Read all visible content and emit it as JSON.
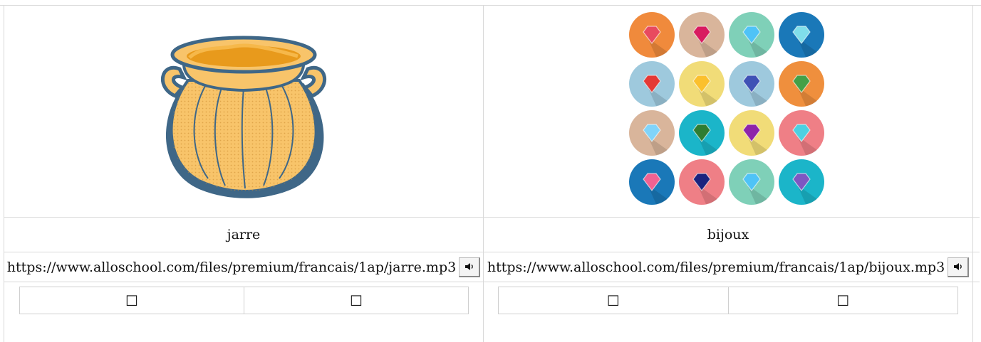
{
  "cards": [
    {
      "image_icon": "cooking-pot-jar-illustration",
      "word": "jarre",
      "audio_url": "https://www.alloschool.com/files/premium/francais/1ap/jarre.mp3",
      "audio_icon": "speaker-icon",
      "choices": [
        "☐",
        "☐"
      ]
    },
    {
      "image_icon": "jewelry-icons-grid",
      "word": "bijoux",
      "audio_url": "https://www.alloschool.com/files/premium/francais/1ap/bijoux.mp3",
      "audio_icon": "speaker-icon",
      "choices": [
        "☐",
        "☐"
      ]
    }
  ],
  "colors": {
    "pot_fill": "#f8c46a",
    "pot_outline": "#3f6787",
    "grid_line": "#d9d9d9",
    "jewel_circles": [
      "#f08a3c",
      "#d9b59b",
      "#7fd0b8",
      "#1a78b8",
      "#9ec9dd",
      "#f1dc78",
      "#9ec9dd",
      "#ef8f3d",
      "#d9b59b",
      "#1bb5c9",
      "#f1dc78",
      "#ef7f86",
      "#1a78b8",
      "#ef7f86",
      "#7fd0b8",
      "#1bb5c9"
    ]
  }
}
